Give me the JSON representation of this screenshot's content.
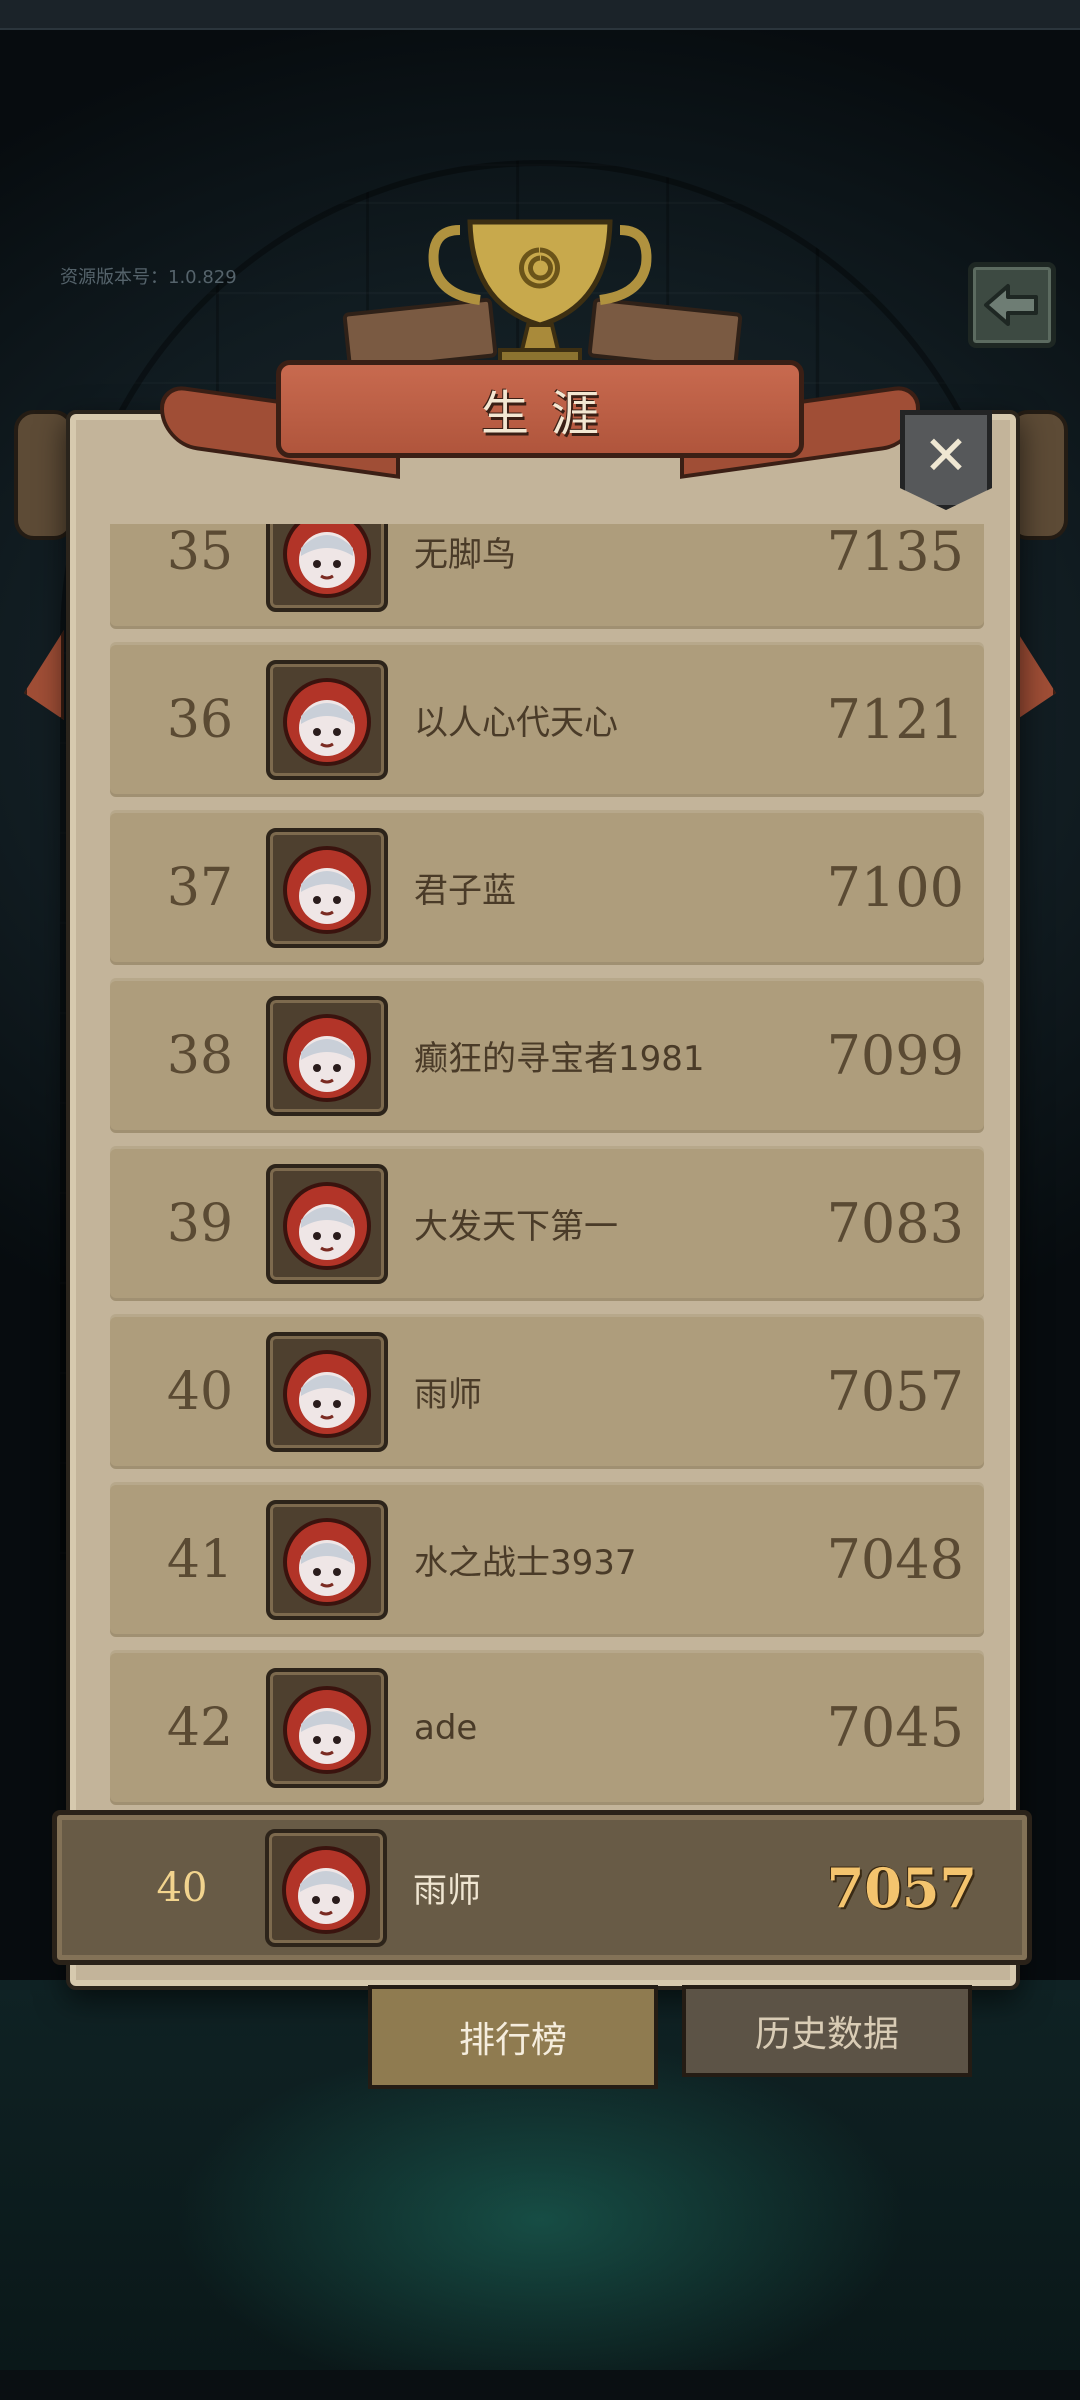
{
  "version_label": "资源版本号：1.0.829",
  "title": "生涯",
  "close_label": "✕",
  "rows": [
    {
      "rank": "35",
      "name": "无脚鸟",
      "score": "7135"
    },
    {
      "rank": "36",
      "name": "以人心代天心",
      "score": "7121"
    },
    {
      "rank": "37",
      "name": "君子蓝",
      "score": "7100"
    },
    {
      "rank": "38",
      "name": "癫狂的寻宝者1981",
      "score": "7099"
    },
    {
      "rank": "39",
      "name": "大发天下第一",
      "score": "7083"
    },
    {
      "rank": "40",
      "name": "雨师",
      "score": "7057"
    },
    {
      "rank": "41",
      "name": "水之战士3937",
      "score": "7048"
    },
    {
      "rank": "42",
      "name": "ade",
      "score": "7045"
    }
  ],
  "me": {
    "rank": "40",
    "name": "雨师",
    "score": "7057"
  },
  "tabs": {
    "ranking": "排行榜",
    "history": "历史数据"
  },
  "icons": {
    "back": "back-arrow-icon",
    "close": "close-icon",
    "trophy": "trophy-icon",
    "avatar": "red-hood-avatar-icon"
  },
  "colors": {
    "panel": "#c3b49a",
    "row": "#ae9d7c",
    "ribbon": "#b0553c",
    "score_highlight": "#f4c46e"
  }
}
